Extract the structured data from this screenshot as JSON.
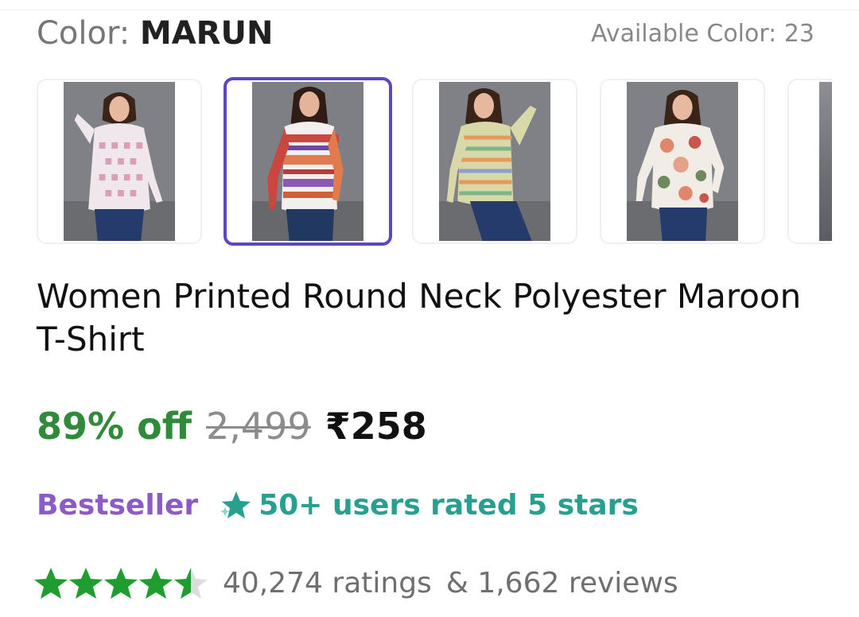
{
  "color": {
    "label": "Color: ",
    "value": "MARUN",
    "available_text": "Available Color: 23"
  },
  "thumbnails": [
    {
      "name": "white-geometric-print",
      "selected": false,
      "accent": "#e7c9d2"
    },
    {
      "name": "maroon-nordic-print",
      "selected": true,
      "accent": "#c94b4b"
    },
    {
      "name": "olive-stripe-print",
      "selected": false,
      "accent": "#cfd19a"
    },
    {
      "name": "floral-print",
      "selected": false,
      "accent": "#e6a18d"
    },
    {
      "name": "partial-next",
      "selected": false,
      "accent": "#8d8f94"
    }
  ],
  "product": {
    "title": "Women Printed Round Neck Polyester Maroon T-Shirt"
  },
  "price": {
    "discount": "89% off",
    "mrp": "2,499",
    "sale": "₹258"
  },
  "badges": {
    "bestseller": "Bestseller",
    "rated_text": "50+ users rated 5 stars"
  },
  "rating": {
    "stars": 4.5,
    "ratings_text": "40,274 ratings",
    "reviews_text": "& 1,662 reviews"
  },
  "colors": {
    "selected_border": "#5b47c4",
    "discount_green": "#2f8a3a",
    "bestseller_purple": "#8b5cc8",
    "rated_teal": "#27a08f",
    "star_green": "#1f9d2f"
  }
}
